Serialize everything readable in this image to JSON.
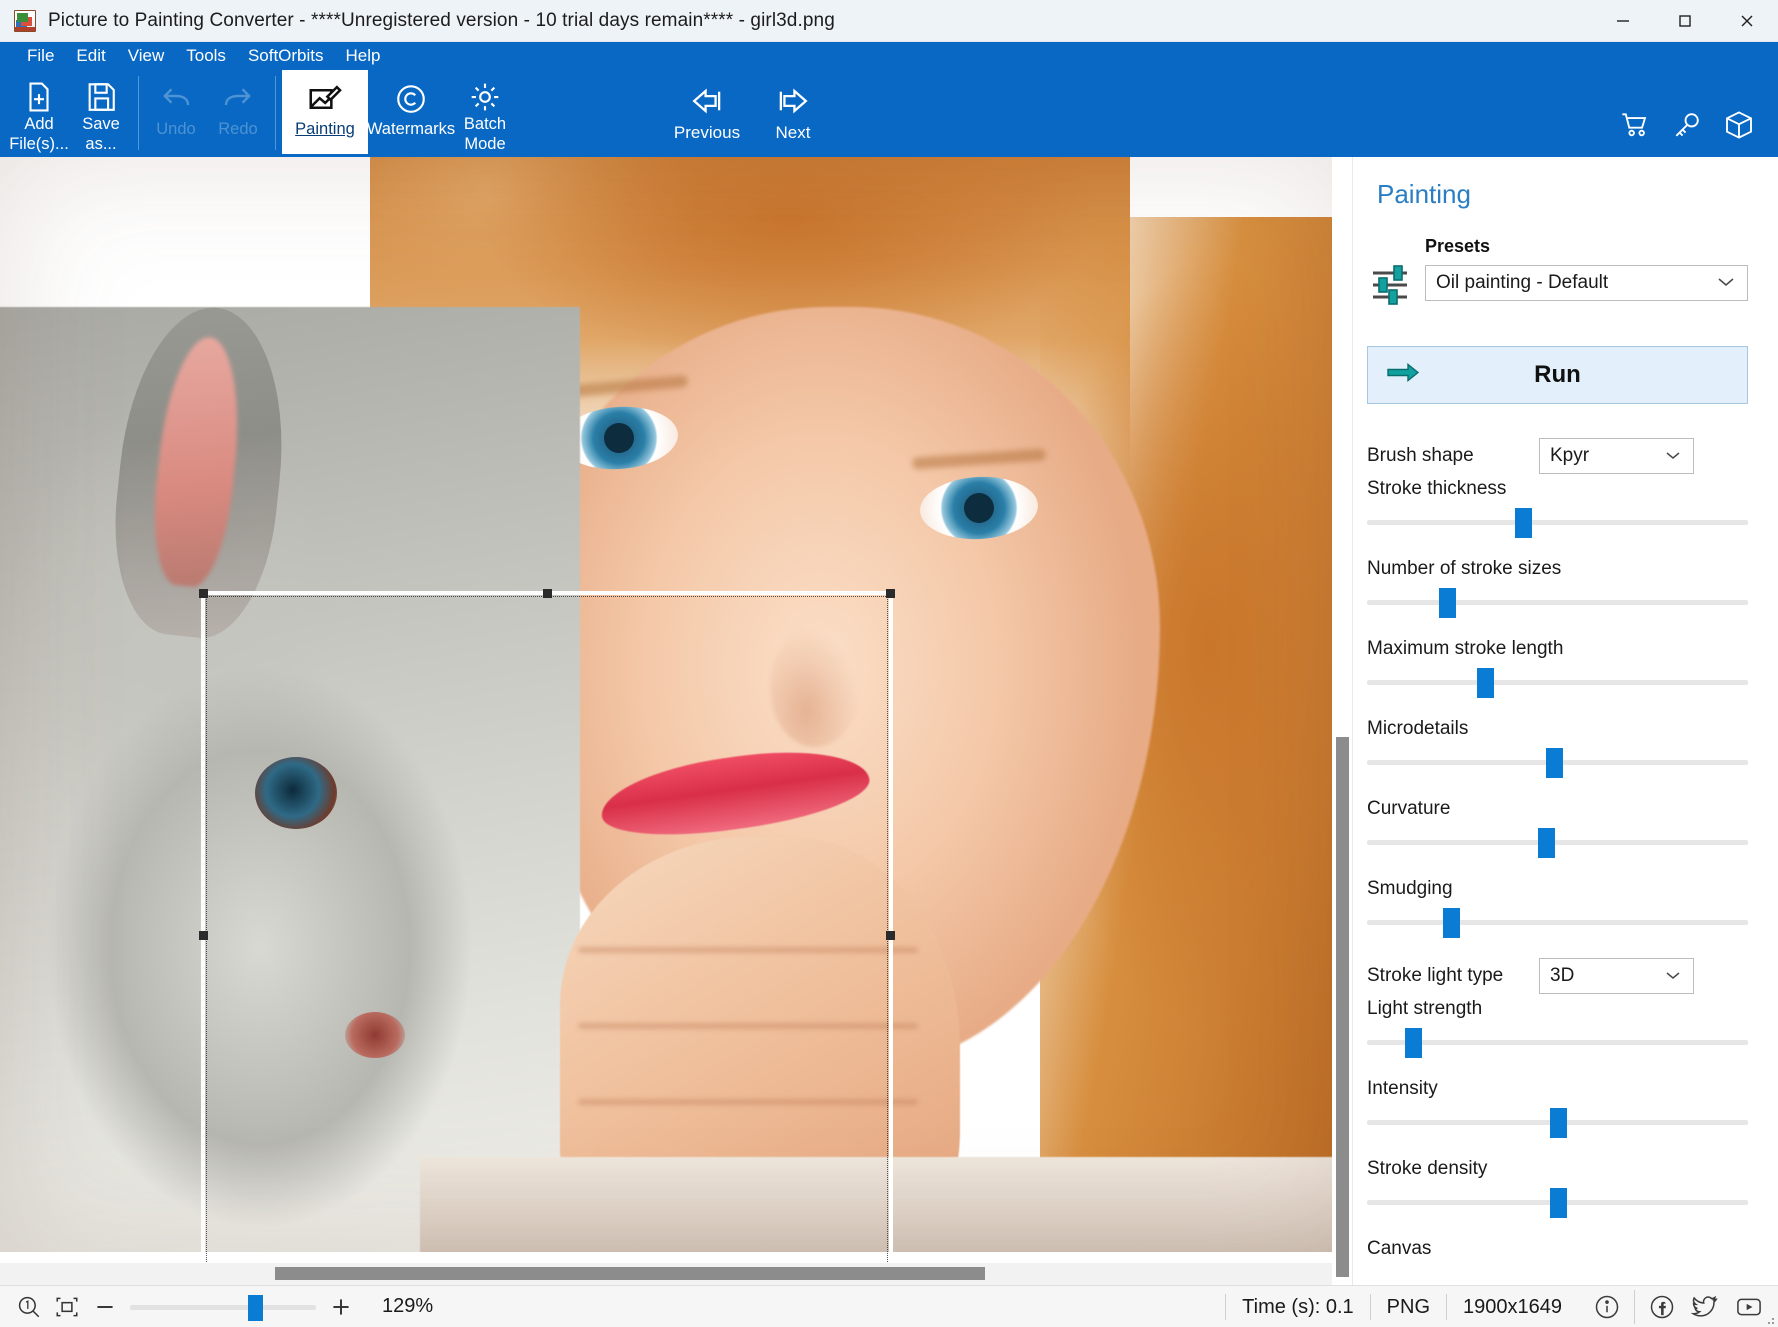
{
  "window": {
    "title": "Picture to Painting Converter - ****Unregistered version - 10 trial days remain**** - girl3d.png",
    "app_icon": "app-icon",
    "minimize": "—",
    "maximize": "☐",
    "close": "✕"
  },
  "menubar": [
    {
      "label": "File",
      "accel": "F"
    },
    {
      "label": "Edit",
      "accel": "E"
    },
    {
      "label": "View",
      "accel": "V"
    },
    {
      "label": "Tools",
      "accel": "T"
    },
    {
      "label": "SoftOrbits",
      "accel": ""
    },
    {
      "label": "Help",
      "accel": "H"
    }
  ],
  "toolbar": {
    "add_files": "Add\nFile(s)...",
    "add_files_l1": "Add",
    "add_files_l2": "File(s)...",
    "save_as_l1": "Save",
    "save_as_l2": "as...",
    "undo": "Undo",
    "redo": "Redo",
    "painting": "Painting",
    "watermarks": "Watermarks",
    "batch_l1": "Batch",
    "batch_l2": "Mode",
    "previous": "Previous",
    "next": "Next",
    "cart_icon": "cart-icon",
    "key_icon": "key-icon",
    "box_icon": "box-icon"
  },
  "panel": {
    "title": "Painting",
    "presets_label": "Presets",
    "presets_value": "Oil painting - Default",
    "run_label": "Run",
    "brush_shape_label": "Brush shape",
    "brush_shape_value": "Kpyr",
    "stroke_light_type_label": "Stroke light type",
    "stroke_light_type_value": "3D",
    "sliders": [
      {
        "label": "Stroke thickness",
        "percent": 41
      },
      {
        "label": "Number of stroke sizes",
        "percent": 21
      },
      {
        "label": "Maximum stroke length",
        "percent": 31
      },
      {
        "label": "Microdetails",
        "percent": 49
      },
      {
        "label": "Curvature",
        "percent": 47
      },
      {
        "label": "Smudging",
        "percent": 22
      },
      {
        "label": "Light strength",
        "percent": 12
      },
      {
        "label": "Intensity",
        "percent": 50
      },
      {
        "label": "Stroke density",
        "percent": 50
      }
    ],
    "next_label_clipped": "Canvas"
  },
  "statusbar": {
    "zoom_reset_icon": "zoom-one-to-one-icon",
    "fit_icon": "fit-to-window-icon",
    "zoom_out": "−",
    "zoom_in": "+",
    "zoom_percent": "129%",
    "time": "Time (s): 0.1",
    "format": "PNG",
    "dimensions": "1900x1649",
    "info_icon": "info-icon",
    "facebook_icon": "facebook-icon",
    "twitter_icon": "twitter-icon",
    "youtube_icon": "youtube-icon"
  },
  "colors": {
    "ribbon": "#0968c3",
    "accent": "#0a7cd4",
    "panel_title": "#2b7dc4",
    "run_bg": "#e3f0fb",
    "teal": "#12a0a0"
  }
}
